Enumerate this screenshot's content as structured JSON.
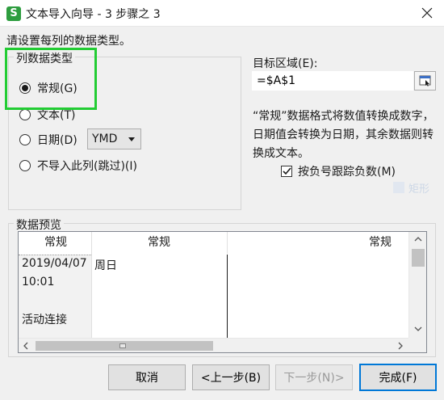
{
  "window": {
    "title": "文本导入向导 - 3 步骤之 3",
    "app_icon_letter": "S",
    "accent_color": "#0078d7",
    "highlight_color": "#22cc33"
  },
  "prompt": "请设置每列的数据类型。",
  "column_type": {
    "legend": "列数据类型",
    "options": [
      {
        "label": "常规(G)",
        "selected": true
      },
      {
        "label": "文本(T)",
        "selected": false
      },
      {
        "label": "日期(D)",
        "selected": false
      },
      {
        "label": "不导入此列(跳过)(I)",
        "selected": false
      }
    ],
    "date_format": "YMD"
  },
  "target": {
    "label": "目标区域(E):",
    "value": "=$A$1"
  },
  "description": "“常规”数据格式将数值转换成数字，日期值会转换为日期，其余数据则转换成文本。",
  "negative_checkbox": {
    "label": "按负号跟踪负数(M)",
    "checked": true
  },
  "ghost_text": "矩形",
  "preview": {
    "legend": "数据预览",
    "headers": [
      "常规",
      "常规",
      "常规"
    ],
    "rows": [
      [
        "2019/04/07",
        "周日"
      ],
      [
        "10:01",
        ""
      ],
      [
        "",
        ""
      ],
      [
        "活动连接",
        ""
      ]
    ]
  },
  "buttons": {
    "cancel": "取消",
    "back": "<上一步(B)",
    "next": "下一步(N)>",
    "finish": "完成(F)"
  }
}
